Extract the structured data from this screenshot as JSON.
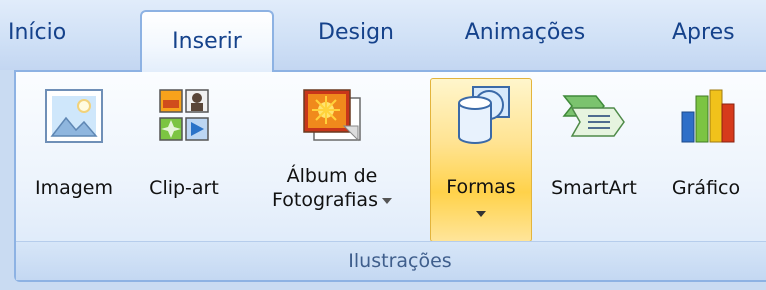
{
  "tabs": [
    {
      "label": "Início"
    },
    {
      "label": "Inserir"
    },
    {
      "label": "Design"
    },
    {
      "label": "Animações"
    },
    {
      "label": "Apres"
    }
  ],
  "ribbon": {
    "group_label": "Ilustrações",
    "buttons": [
      {
        "label": "Imagem",
        "icon": "picture-icon"
      },
      {
        "label": "Clip-art",
        "icon": "clip-art-icon"
      },
      {
        "label_line1": "Álbum de",
        "label_line2": "Fotografias",
        "icon": "photo-album-icon"
      },
      {
        "label": "Formas",
        "icon": "shapes-icon"
      },
      {
        "label": "SmartArt",
        "icon": "smartart-icon"
      },
      {
        "label": "Gráfico",
        "icon": "chart-icon"
      }
    ]
  },
  "colors": {
    "tab_text": "#15428b",
    "ribbon_bg": "#c9dbf2",
    "highlight": "#ffd24a"
  }
}
